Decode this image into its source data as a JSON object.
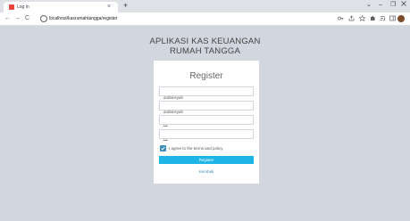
{
  "browser": {
    "tab_title": "Log in",
    "tab_close": "×",
    "new_tab": "+",
    "window_controls": {
      "chevron": "⌄",
      "minimize": "–",
      "maximize": "❐"
    },
    "nav": {
      "back": "←",
      "forward": "→",
      "reload": "C"
    },
    "url": "localhost/kasrumahtangga/register"
  },
  "page": {
    "app_title_line1": "APLIKASI KAS KEUANGAN",
    "app_title_line2": "RUMAH TANGGA"
  },
  "register_form": {
    "title": "Register",
    "full_name_value": "ardiansyah",
    "username_value": "ardiansyah",
    "password_value": "•••",
    "retype_password_value": "•••",
    "agree_label": "I agree to the terms and policy",
    "agree_checked": true,
    "submit_label": "Register",
    "login_link": "Kembali"
  },
  "colors": {
    "page_background": "#d2d6de",
    "primary_button": "#1fb4e6",
    "checkbox": "#3c8dbc",
    "link": "#3c8dbc"
  }
}
